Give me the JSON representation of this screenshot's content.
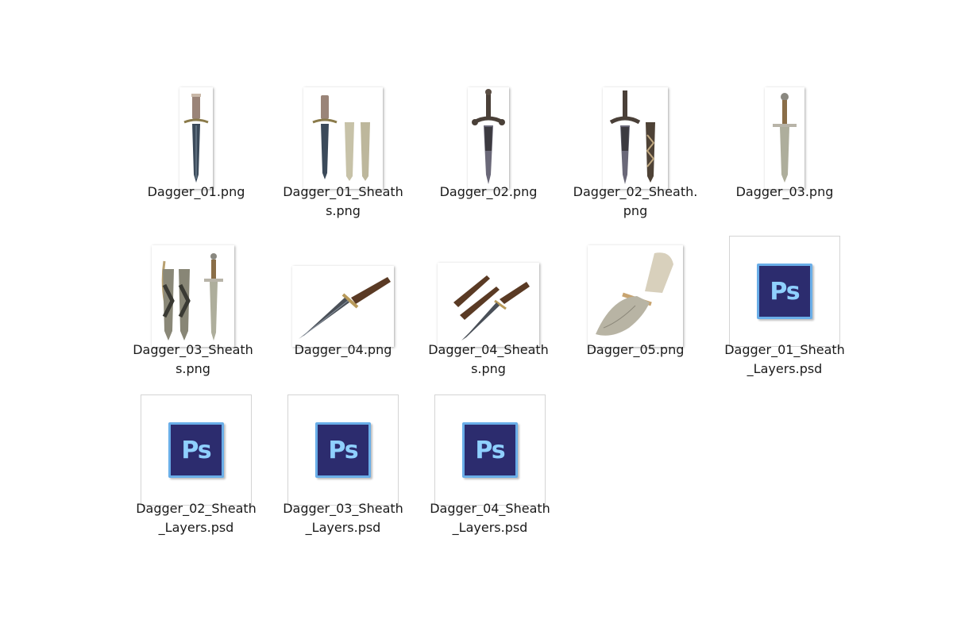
{
  "files": [
    {
      "name": "Dagger_01.png",
      "type": "png",
      "icon": "dagger-thumbnail-icon"
    },
    {
      "name": "Dagger_01_Sheaths.png",
      "type": "png",
      "icon": "dagger-with-sheaths-thumbnail-icon"
    },
    {
      "name": "Dagger_02.png",
      "type": "png",
      "icon": "ornate-dagger-thumbnail-icon"
    },
    {
      "name": "Dagger_02_Sheath.png",
      "type": "png",
      "icon": "ornate-dagger-with-sheath-thumbnail-icon"
    },
    {
      "name": "Dagger_03.png",
      "type": "png",
      "icon": "dagger-thumbnail-icon"
    },
    {
      "name": "Dagger_03_Sheaths.png",
      "type": "png",
      "icon": "dagger-with-sheaths-thumbnail-icon"
    },
    {
      "name": "Dagger_04.png",
      "type": "png",
      "icon": "horizontal-dagger-thumbnail-icon"
    },
    {
      "name": "Dagger_04_Sheaths.png",
      "type": "png",
      "icon": "dagger-with-sheaths-thumbnail-icon"
    },
    {
      "name": "Dagger_05.png",
      "type": "png",
      "icon": "bone-knife-thumbnail-icon"
    },
    {
      "name": "Dagger_01_Sheath_Layers.psd",
      "type": "psd",
      "icon": "photoshop-icon",
      "icon_text": "Ps"
    },
    {
      "name": "Dagger_02_Sheath_Layers.psd",
      "type": "psd",
      "icon": "photoshop-icon",
      "icon_text": "Ps"
    },
    {
      "name": "Dagger_03_Sheath_Layers.psd",
      "type": "psd",
      "icon": "photoshop-icon",
      "icon_text": "Ps"
    },
    {
      "name": "Dagger_04_Sheath_Layers.psd",
      "type": "psd",
      "icon": "photoshop-icon",
      "icon_text": "Ps"
    }
  ],
  "colors": {
    "background": "#ffffff",
    "text": "#1a1a1a",
    "ps_dark": "#2c2c6e",
    "ps_border": "#6aaee8",
    "ps_text": "#8fd0ff"
  }
}
